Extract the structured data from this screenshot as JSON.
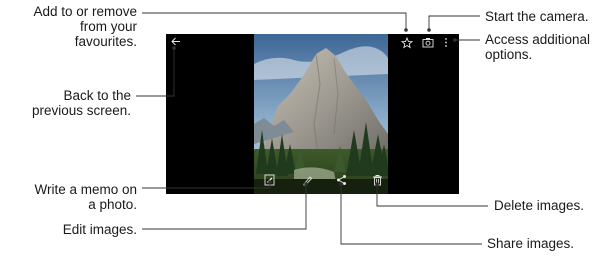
{
  "annotations": {
    "favourite_line1": "Add to or remove",
    "favourite_line2": "from your",
    "favourite_line3": "favourites.",
    "back_line1": "Back to the",
    "back_line2": "previous screen.",
    "memo_line1": "Write a memo on",
    "memo_line2": "a photo.",
    "edit": "Edit images.",
    "camera": "Start the camera.",
    "options_line1": "Access additional",
    "options_line2": "options.",
    "delete": "Delete images.",
    "share": "Share images."
  },
  "icons": {
    "back": "back-arrow-icon",
    "star": "star-icon",
    "camera": "camera-icon",
    "more": "more-options-icon",
    "memo": "memo-icon",
    "edit": "edit-pencil-icon",
    "share": "share-icon",
    "delete": "trash-icon"
  },
  "colors": {
    "screen_background": "#000000",
    "callout_line": "#333333",
    "icon_color": "#e8e8e8"
  }
}
